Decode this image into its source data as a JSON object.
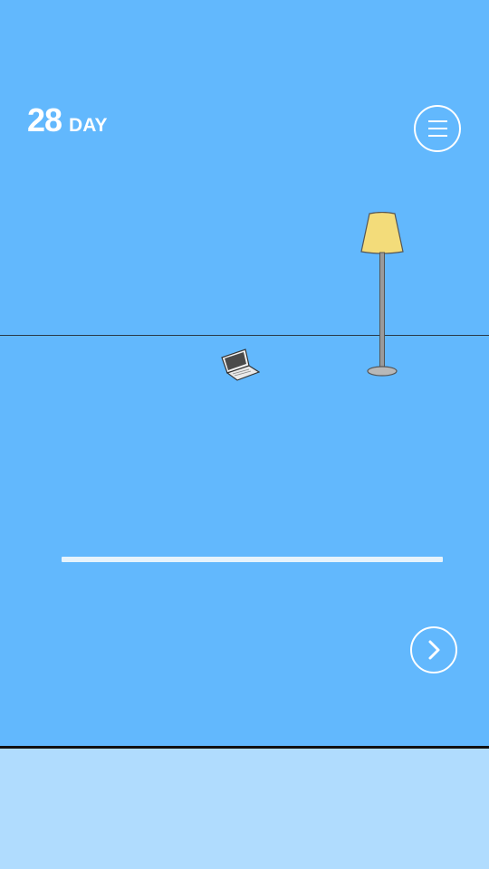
{
  "hud": {
    "day_number": "28",
    "day_label": "DAY"
  },
  "icons": {
    "menu": "hamburger-menu-icon",
    "next": "chevron-right-icon",
    "lamp": "floor-lamp",
    "laptop": "laptop"
  },
  "colors": {
    "sky": "#62b8fd",
    "bottom_panel": "#b0dcfe",
    "lamp_shade": "#f3dc7a",
    "hud_text": "#ffffff"
  }
}
